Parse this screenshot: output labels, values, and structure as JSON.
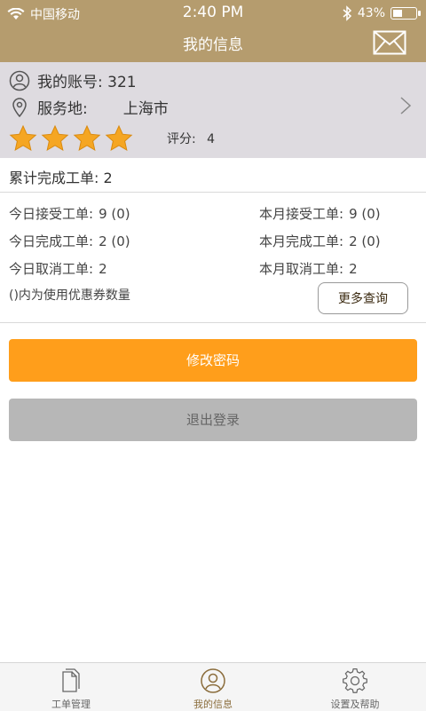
{
  "status_bar": {
    "carrier": "中国移动",
    "time": "2:40 PM",
    "battery_text": "43%",
    "battery_level": 0.43
  },
  "nav": {
    "title": "我的信息",
    "mail_icon": "mail-icon"
  },
  "profile": {
    "account": "我的账号: 321",
    "service_label": "服务地:",
    "service_city": "上海市",
    "stars": 4,
    "rating_label": "评分:",
    "rating_value": "4"
  },
  "summary": {
    "total": "累计完成工单: 2"
  },
  "stats": {
    "today_accept_label": "今日接受工单:",
    "today_accept_value": "9  (0)",
    "month_accept_label": "本月接受工单:",
    "month_accept_value": "9  (0)",
    "today_done_label": "今日完成工单:",
    "today_done_value": "2  (0)",
    "month_done_label": "本月完成工单:",
    "month_done_value": "2  (0)",
    "today_cancel_label": "今日取消工单:",
    "today_cancel_value": "2",
    "month_cancel_label": "本月取消工单:",
    "month_cancel_value": "2"
  },
  "note": "()内为使用优惠券数量",
  "buttons": {
    "more": "更多查询",
    "change_password": "修改密码",
    "logout": "退出登录"
  },
  "tabs": [
    {
      "label": "工单管理",
      "icon": "document-icon",
      "active": false
    },
    {
      "label": "我的信息",
      "icon": "user-icon",
      "active": true
    },
    {
      "label": "设置及帮助",
      "icon": "gear-icon",
      "active": false
    }
  ],
  "colors": {
    "header": "#b59c6e",
    "primary_button": "#ff9e1b",
    "secondary_button": "#b7b7b7",
    "star": "#f5a623"
  }
}
